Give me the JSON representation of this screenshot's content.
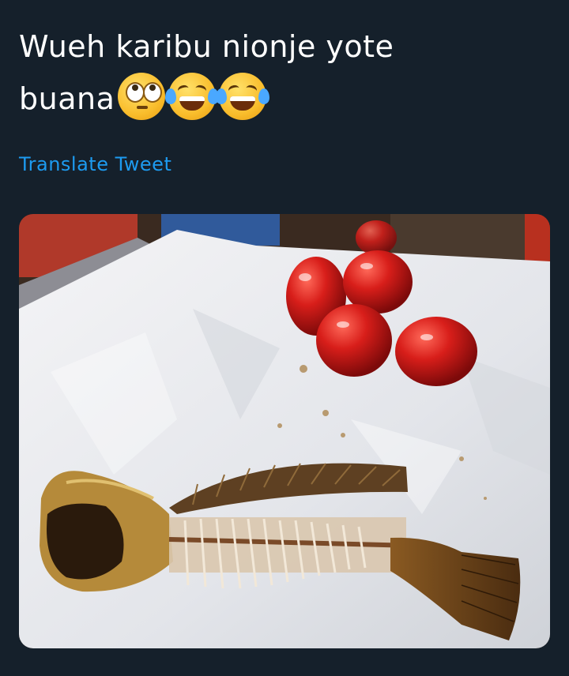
{
  "tweet": {
    "text_line1": "Wueh karibu nionje yote",
    "text_line2": "buana",
    "emojis": [
      "face-with-rolling-eyes",
      "face-with-tears-of-joy",
      "face-with-tears-of-joy"
    ],
    "translate_label": "Translate Tweet"
  },
  "colors": {
    "background": "#15202b",
    "text": "#ffffff",
    "link": "#1d9bf0"
  }
}
